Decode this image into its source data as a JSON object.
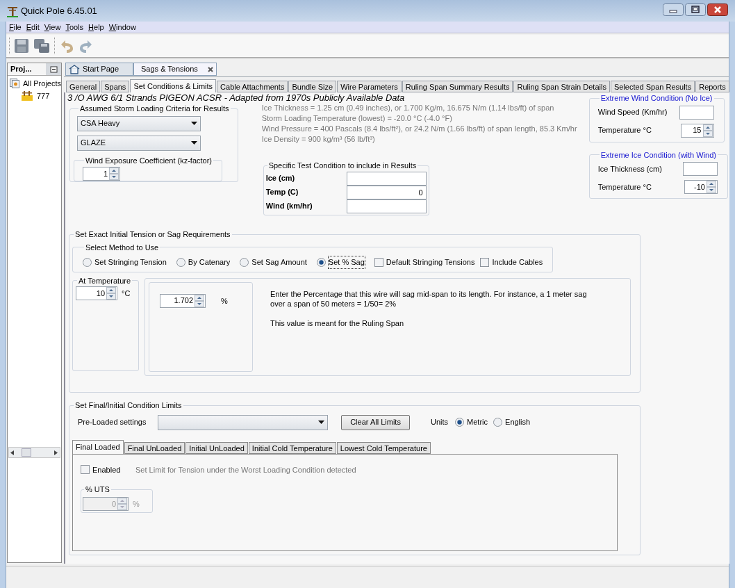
{
  "window": {
    "title": "Quick Pole 6.45.01"
  },
  "menu": [
    "File",
    "Edit",
    "View",
    "Tools",
    "Help",
    "Window"
  ],
  "project_panel": {
    "title": "Proj...",
    "tree": [
      {
        "label": "All Projects",
        "children": [
          {
            "label": "777"
          }
        ]
      }
    ]
  },
  "doc_tabs": [
    {
      "label": "Start Page",
      "selected": false,
      "closable": false
    },
    {
      "label": "Sags & Tensions",
      "selected": true,
      "closable": true
    }
  ],
  "sub_tabs": [
    {
      "label": "General",
      "selected": false
    },
    {
      "label": "Spans",
      "selected": false
    },
    {
      "label": "Set Conditions & Limits",
      "selected": true
    },
    {
      "label": "Cable Attachments",
      "selected": false
    },
    {
      "label": "Bundle Size",
      "selected": false
    },
    {
      "label": "Wire Parameters",
      "selected": false
    },
    {
      "label": "Ruling Span Summary Results",
      "selected": false
    },
    {
      "label": "Ruling Span Strain Details",
      "selected": false
    },
    {
      "label": "Selected Span Results",
      "selected": false
    },
    {
      "label": "Reports",
      "selected": false
    }
  ],
  "conductor_heading": "3 /O AWG 6/1 Strands PIGEON ACSR - Adapted from 1970s Publicly Available Data",
  "storm_criteria": {
    "title": "Assumed Storm Loading Criteria for Results",
    "dropdowns": [
      "CSA Heavy",
      "GLAZE"
    ],
    "kz": {
      "title": "Wind Exposure Coefficient (kz-factor)",
      "value": "1"
    }
  },
  "loading_info": [
    "Ice Thickness = 1.25 cm (0.49 inches), or 1.700 Kg/m, 16.675 N/m (1.14 lbs/ft) of span",
    "Storm Loading Temperature (lowest) = -20.0 °C (-4.0 °F)",
    "Wind Pressure = 400 Pascals (8.4 lbs/ft²), or 24.2 N/m (1.66 lbs/ft) of span length, 85.3 Km/hr",
    "Ice Density = 900 kg/m³ (56 lb/ft³)"
  ],
  "test_condition": {
    "title": "Specific Test Condition to include in Results",
    "rows": [
      {
        "label": "Ice (cm)"
      },
      {
        "label": "Temp (C)",
        "value": "0"
      },
      {
        "label": "Wind (km/hr)"
      }
    ]
  },
  "extreme_wind": {
    "title": "Extreme Wind Condition (No Ice)",
    "rows": [
      {
        "label": "Wind Speed (Km/hr)",
        "kind": "text"
      },
      {
        "label": "Temperature °C",
        "kind": "spinner",
        "value": "15"
      }
    ]
  },
  "extreme_ice": {
    "title": "Extreme Ice Condition (with Wind)",
    "rows": [
      {
        "label": "Ice Thickness (cm)",
        "kind": "text"
      },
      {
        "label": "Temperature °C",
        "kind": "spinner",
        "value": "-10"
      }
    ]
  },
  "sag_requirements": {
    "title": "Set Exact Initial Tension or Sag Requirements",
    "method": {
      "title": "Select Method to Use",
      "options": [
        {
          "label": "Set Stringing Tension",
          "kind": "radio",
          "selected": false
        },
        {
          "label": "By Catenary",
          "kind": "radio",
          "selected": false
        },
        {
          "label": "Set Sag Amount",
          "kind": "radio",
          "selected": false
        },
        {
          "label": "Set % Sag",
          "kind": "radio",
          "selected": true
        },
        {
          "label": "Default Stringing Tensions",
          "kind": "checkbox",
          "checked": false
        },
        {
          "label": "Include Cables",
          "kind": "checkbox",
          "checked": false
        }
      ]
    },
    "at_temperature": {
      "title": "At Temperature",
      "value": "10",
      "unit": "°C"
    },
    "sag_percent": {
      "value": "1.702",
      "unit": "%"
    },
    "description": [
      "Enter the Percentage that this wire will sag mid-span to its length. For instance, a 1 meter sag over a span of 50 meters = 1/50= 2%",
      "This value is meant for the Ruling Span"
    ]
  },
  "limits": {
    "title": "Set Final/Initial Condition Limits",
    "preloaded_label": "Pre-Loaded settings",
    "clear_button": "Clear All Limits",
    "units": {
      "label": "Units",
      "options": [
        {
          "label": "Metric",
          "selected": true
        },
        {
          "label": "English",
          "selected": false
        }
      ]
    },
    "tabs": [
      {
        "label": "Final Loaded",
        "selected": true
      },
      {
        "label": "Final UnLoaded",
        "selected": false
      },
      {
        "label": "Initial UnLoaded",
        "selected": false
      },
      {
        "label": "Initial Cold Temperature",
        "selected": false
      },
      {
        "label": "Lowest Cold Temperature",
        "selected": false
      }
    ],
    "enabled": {
      "label": "Enabled",
      "checked": false
    },
    "hint": "Set Limit for Tension under the Worst Loading Condition detected",
    "uts": {
      "title": "% UTS",
      "value": "0",
      "unit": "%",
      "disabled": true
    }
  }
}
